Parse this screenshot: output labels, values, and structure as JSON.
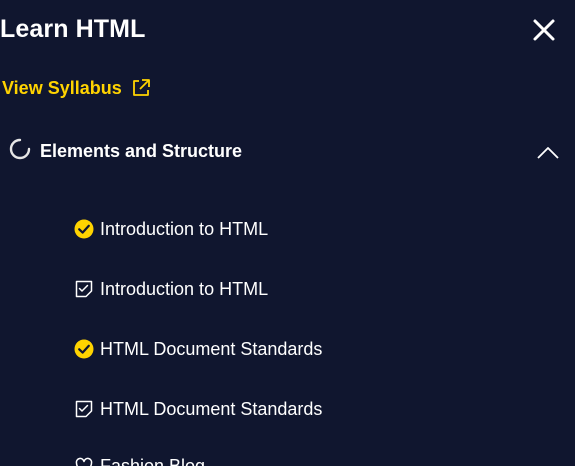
{
  "header": {
    "title": "Learn HTML",
    "close_icon": "close-icon"
  },
  "syllabus_link": {
    "label": "View Syllabus",
    "icon": "external-link-icon",
    "color": "#ffd300"
  },
  "section": {
    "title": "Elements and Structure",
    "status_icon": "progress-spinner-icon",
    "expanded": true,
    "toggle_icon": "chevron-up-icon"
  },
  "lessons": [
    {
      "label": "Introduction to HTML",
      "type": "lesson",
      "completed": true,
      "icon": "check-circle-icon"
    },
    {
      "label": "Introduction to HTML",
      "type": "quiz",
      "completed": false,
      "icon": "quiz-icon"
    },
    {
      "label": "HTML Document Standards",
      "type": "lesson",
      "completed": true,
      "icon": "check-circle-icon"
    },
    {
      "label": "HTML Document Standards",
      "type": "quiz",
      "completed": false,
      "icon": "quiz-icon"
    },
    {
      "label": "Fashion Blog",
      "type": "project",
      "completed": false,
      "icon": "project-icon"
    }
  ],
  "colors": {
    "background": "#10162f",
    "accent": "#ffd300",
    "text": "#ffffff"
  }
}
